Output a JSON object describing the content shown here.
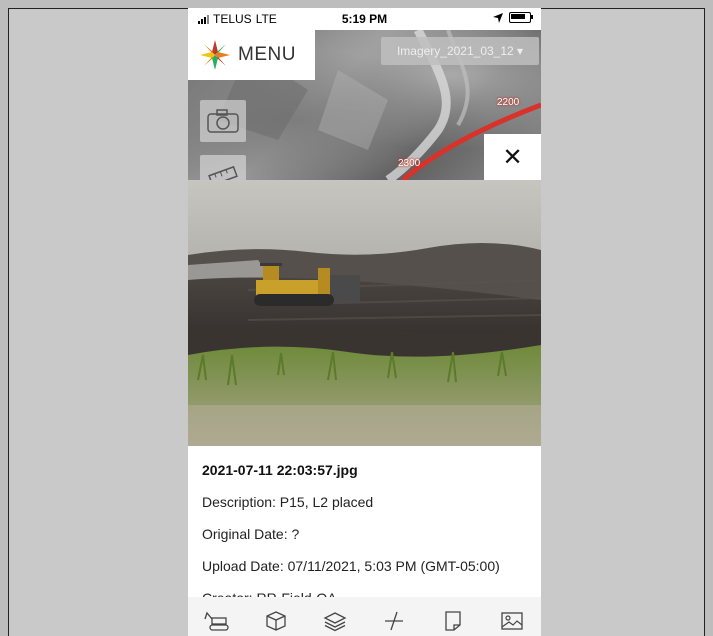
{
  "status_bar": {
    "carrier": "TELUS",
    "network": "LTE",
    "time": "5:19 PM"
  },
  "map": {
    "menu_label": "MENU",
    "imagery_select": "Imagery_2021_03_12 ▾",
    "labels": [
      "2200",
      "2300"
    ],
    "route_color": "#d8322a"
  },
  "close_symbol": "✕",
  "photo_info": {
    "filename": "2021-07-11 22:03:57.jpg",
    "description": "Description: P15, L2 placed",
    "original_date": "Original Date: ?",
    "upload_date": "Upload Date: 07/11/2021, 5:03 PM (GMT-05:00)",
    "creator": "Creator: RR-Field-QA"
  },
  "toolbar": {
    "items": [
      "excavator-icon",
      "box-3d-icon",
      "layers-icon",
      "measure-icon",
      "note-icon",
      "image-icon"
    ]
  }
}
